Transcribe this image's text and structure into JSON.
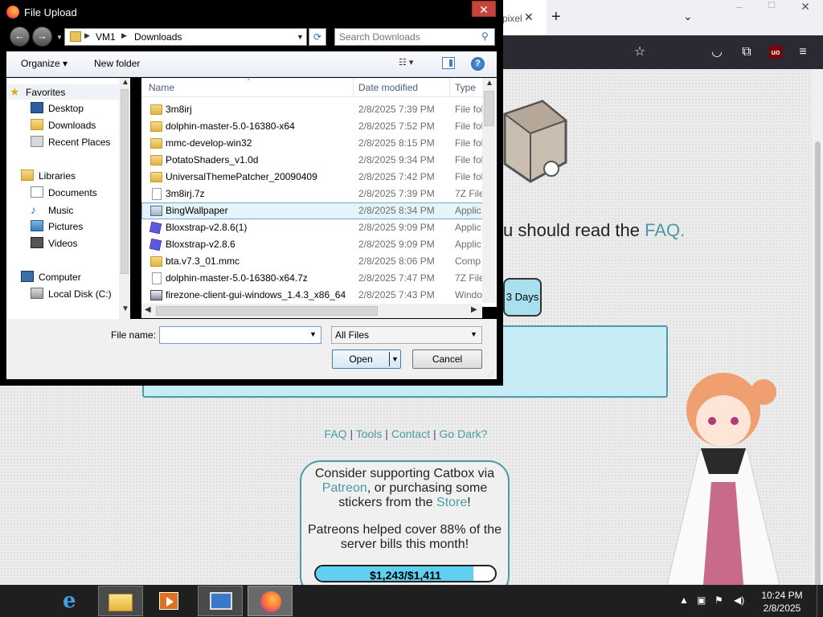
{
  "browser": {
    "tab_title_fragment": "pixel",
    "page_text_prefix": "u should read the ",
    "faq_link": "FAQ.",
    "days_button": "3 Days",
    "footer_links": [
      "FAQ",
      "Tools",
      "Contact",
      "Go Dark?"
    ],
    "support": {
      "line1": "Consider supporting Catbox via",
      "patreon": "Patreon",
      "line2_rest": ", or purchasing some",
      "line3_pre": "stickers from the ",
      "store": "Store",
      "line3_post": "!",
      "patrons_line1": "Patreons helped cover 88% of the",
      "patrons_line2": "server bills this month!",
      "progress_text": "$1,243/$1,411",
      "progress_fraction": 0.88
    }
  },
  "dialog": {
    "title": "File Upload",
    "breadcrumb": [
      "VM1",
      "Downloads"
    ],
    "search_placeholder": "Search Downloads",
    "toolbar": {
      "organize": "Organize",
      "new_folder": "New folder"
    },
    "nav_pane": {
      "favorites": "Favorites",
      "desktop": "Desktop",
      "downloads": "Downloads",
      "recent_places": "Recent Places",
      "libraries": "Libraries",
      "documents": "Documents",
      "music": "Music",
      "pictures": "Pictures",
      "videos": "Videos",
      "computer": "Computer",
      "local_disk": "Local Disk (C:)"
    },
    "columns": {
      "name": "Name",
      "date_modified": "Date modified",
      "type": "Type"
    },
    "files": [
      {
        "name": "3m8irj",
        "date": "2/8/2025 7:39 PM",
        "type": "File fol",
        "icon": "folder"
      },
      {
        "name": "dolphin-master-5.0-16380-x64",
        "date": "2/8/2025 7:52 PM",
        "type": "File fol",
        "icon": "folder"
      },
      {
        "name": "mmc-develop-win32",
        "date": "2/8/2025 8:15 PM",
        "type": "File fol",
        "icon": "folder"
      },
      {
        "name": "PotatoShaders_v1.0d",
        "date": "2/8/2025 9:34 PM",
        "type": "File fol",
        "icon": "folder"
      },
      {
        "name": "UniversalThemePatcher_20090409",
        "date": "2/8/2025 7:42 PM",
        "type": "File fol",
        "icon": "folder"
      },
      {
        "name": "3m8irj.7z",
        "date": "2/8/2025 7:39 PM",
        "type": "7Z File",
        "icon": "file"
      },
      {
        "name": "BingWallpaper",
        "date": "2/8/2025 8:34 PM",
        "type": "Applic",
        "icon": "app",
        "selected": true
      },
      {
        "name": "Bloxstrap-v2.8.6(1)",
        "date": "2/8/2025 9:09 PM",
        "type": "Applic",
        "icon": "blox"
      },
      {
        "name": "Bloxstrap-v2.8.6",
        "date": "2/8/2025 9:09 PM",
        "type": "Applic",
        "icon": "blox"
      },
      {
        "name": "bta.v7.3_01.mmc",
        "date": "2/8/2025 8:06 PM",
        "type": "Comp",
        "icon": "mmc"
      },
      {
        "name": "dolphin-master-5.0-16380-x64.7z",
        "date": "2/8/2025 7:47 PM",
        "type": "7Z File",
        "icon": "file"
      },
      {
        "name": "firezone-client-gui-windows_1.4.3_x86_64",
        "date": "2/8/2025 7:43 PM",
        "type": "Windo",
        "icon": "fz"
      }
    ],
    "file_name_label": "File name:",
    "file_name_value": "",
    "file_type": "All Files",
    "open_button": "Open",
    "cancel_button": "Cancel"
  },
  "taskbar": {
    "time": "10:24 PM",
    "date": "2/8/2025"
  }
}
